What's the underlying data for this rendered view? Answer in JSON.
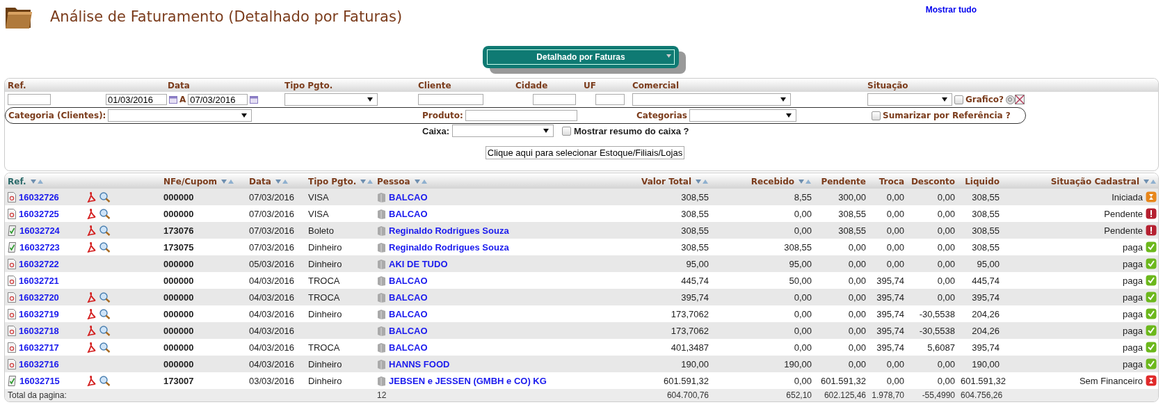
{
  "header": {
    "title": "Análise de Faturamento (Detalhado por Faturas)",
    "show_all_link": "Mostrar tudo"
  },
  "view_select": {
    "value": "Detalhado por Faturas"
  },
  "filters": {
    "labels": [
      "Ref.",
      "Data",
      "Tipo Pgto.",
      "Cliente",
      "Cidade",
      "UF",
      "Comercial",
      "Situação"
    ],
    "date_from": "01/03/2016",
    "date_sep": "A",
    "date_to": "07/03/2016",
    "grafico": {
      "label": "Grafico?",
      "checked": false
    },
    "categoria_label": "Categoria (Clientes):",
    "produto_label": "Produto:",
    "categorias_label": "Categorias",
    "sumarizar": {
      "label": "Sumarizar por Referência ?",
      "checked": false
    },
    "caixa_label": "Caixa:",
    "resumo_caixa": {
      "label": "Mostrar resumo do caixa ?",
      "checked": false
    },
    "select_button": "Clique aqui para selecionar Estoque/Filiais/Lojas"
  },
  "table": {
    "columns": [
      {
        "label": "Ref.",
        "sortable": true,
        "selected": true
      },
      {
        "label": "NFe/Cupom",
        "sortable": true,
        "selected": false
      },
      {
        "label": "Data",
        "sortable": true,
        "selected": false
      },
      {
        "label": "Tipo Pgto.",
        "sortable": true,
        "selected": false
      },
      {
        "label": "Pessoa",
        "sortable": true,
        "selected": false
      },
      {
        "label": "Valor Total",
        "sortable": true,
        "selected": false
      },
      {
        "label": "Recebido",
        "sortable": true,
        "selected": false
      },
      {
        "label": "Pendente",
        "sortable": false,
        "selected": false
      },
      {
        "label": "Troca",
        "sortable": false,
        "selected": false
      },
      {
        "label": "Desconto",
        "sortable": false,
        "selected": false
      },
      {
        "label": "Liquido",
        "sortable": false,
        "selected": false
      },
      {
        "label": "Situação Cadastral",
        "sortable": true,
        "selected": false
      }
    ],
    "rows": [
      {
        "ref": "16032726",
        "signed": false,
        "actions": true,
        "nfe": "000000",
        "date": "07/03/2016",
        "payment": "VISA",
        "person": "BALCAO",
        "total": "308,55",
        "received": "8,55",
        "pending": "300,00",
        "exchange": "0,00",
        "discount": "0,00",
        "net": "308,55",
        "status": "Iniciada",
        "kind": "waiting"
      },
      {
        "ref": "16032725",
        "signed": false,
        "actions": true,
        "nfe": "000000",
        "date": "07/03/2016",
        "payment": "VISA",
        "person": "BALCAO",
        "total": "308,55",
        "received": "0,00",
        "pending": "308,55",
        "exchange": "0,00",
        "discount": "0,00",
        "net": "308,55",
        "status": "Pendente",
        "kind": "alert"
      },
      {
        "ref": "16032724",
        "signed": true,
        "actions": true,
        "nfe": "173076",
        "date": "07/03/2016",
        "payment": "Boleto",
        "person": "Reginaldo Rodrigues Souza",
        "total": "308,55",
        "received": "0,00",
        "pending": "308,55",
        "exchange": "0,00",
        "discount": "0,00",
        "net": "308,55",
        "status": "Pendente",
        "kind": "alert"
      },
      {
        "ref": "16032723",
        "signed": true,
        "actions": true,
        "nfe": "173075",
        "date": "07/03/2016",
        "payment": "Dinheiro",
        "person": "Reginaldo Rodrigues Souza",
        "total": "308,55",
        "received": "308,55",
        "pending": "0,00",
        "exchange": "0,00",
        "discount": "0,00",
        "net": "308,55",
        "status": "paga",
        "kind": "ok"
      },
      {
        "ref": "16032722",
        "signed": false,
        "actions": false,
        "nfe": "000000",
        "date": "05/03/2016",
        "payment": "Dinheiro",
        "person": "AKI DE TUDO",
        "total": "95,00",
        "received": "95,00",
        "pending": "0,00",
        "exchange": "0,00",
        "discount": "0,00",
        "net": "95,00",
        "status": "paga",
        "kind": "ok"
      },
      {
        "ref": "16032721",
        "signed": false,
        "actions": false,
        "nfe": "000000",
        "date": "04/03/2016",
        "payment": "TROCA",
        "person": "BALCAO",
        "total": "445,74",
        "received": "50,00",
        "pending": "0,00",
        "exchange": "395,74",
        "discount": "0,00",
        "net": "445,74",
        "status": "paga",
        "kind": "ok"
      },
      {
        "ref": "16032720",
        "signed": false,
        "actions": true,
        "nfe": "000000",
        "date": "04/03/2016",
        "payment": "TROCA",
        "person": "BALCAO",
        "total": "395,74",
        "received": "0,00",
        "pending": "0,00",
        "exchange": "395,74",
        "discount": "0,00",
        "net": "395,74",
        "status": "paga",
        "kind": "ok"
      },
      {
        "ref": "16032719",
        "signed": false,
        "actions": true,
        "nfe": "000000",
        "date": "04/03/2016",
        "payment": "Dinheiro",
        "person": "BALCAO",
        "total": "173,7062",
        "received": "0,00",
        "pending": "0,00",
        "exchange": "395,74",
        "discount": "-30,5538",
        "net": "204,26",
        "status": "paga",
        "kind": "ok"
      },
      {
        "ref": "16032718",
        "signed": false,
        "actions": true,
        "nfe": "000000",
        "date": "04/03/2016",
        "person": "BALCAO",
        "total": "173,7062",
        "received": "0,00",
        "pending": "0,00",
        "exchange": "395,74",
        "discount": "-30,5538",
        "net": "204,26",
        "status": "paga",
        "kind": "ok"
      },
      {
        "ref": "16032717",
        "signed": false,
        "actions": true,
        "nfe": "000000",
        "date": "04/03/2016",
        "payment": "TROCA",
        "person": "BALCAO",
        "total": "401,3487",
        "received": "0,00",
        "pending": "0,00",
        "exchange": "395,74",
        "discount": "5,6087",
        "net": "395,74",
        "status": "paga",
        "kind": "ok"
      },
      {
        "ref": "16032716",
        "signed": false,
        "actions": false,
        "nfe": "000000",
        "date": "04/03/2016",
        "payment": "Dinheiro",
        "person": "HANNS FOOD",
        "total": "190,00",
        "received": "190,00",
        "pending": "0,00",
        "exchange": "0,00",
        "discount": "0,00",
        "net": "190,00",
        "status": "paga",
        "kind": "ok"
      },
      {
        "ref": "16032715",
        "signed": true,
        "actions": true,
        "nfe": "173007",
        "date": "03/03/2016",
        "payment": "Dinheiro",
        "person": "JEBSEN e JESSEN (GMBH e CO) KG",
        "total": "601.591,32",
        "received": "0,00",
        "pending": "601.591,32",
        "exchange": "0,00",
        "discount": "0,00",
        "net": "601.591,32",
        "status": "Sem Financeiro",
        "kind": "blocked"
      }
    ],
    "total": {
      "label": "Total da pagina:",
      "count": "12",
      "total": "604.700,76",
      "received": "652,10",
      "pending": "602.125,46",
      "exchange": "1.978,70",
      "discount": "-55,4990",
      "net": "604.756,26"
    }
  }
}
